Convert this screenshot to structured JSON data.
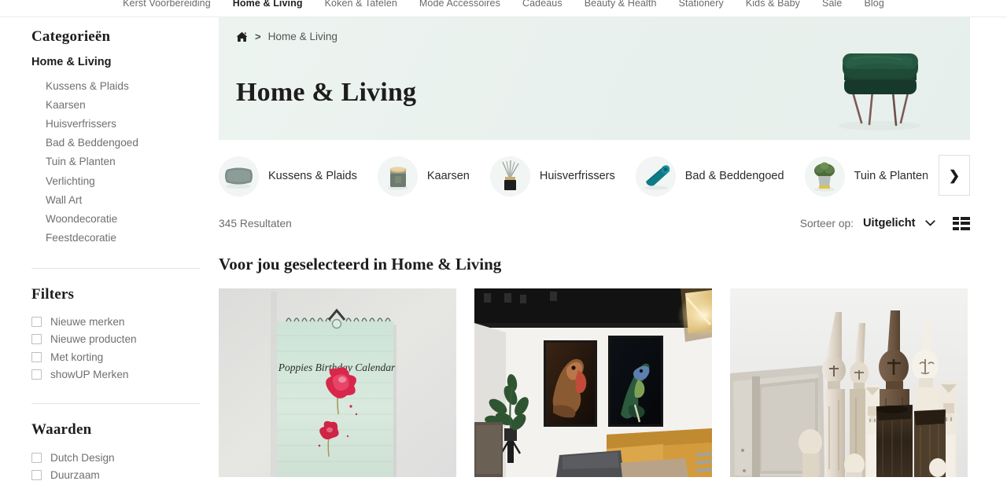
{
  "topnav": {
    "items": [
      {
        "label": "Kerst Voorbereiding",
        "active": false
      },
      {
        "label": "Home & Living",
        "active": true
      },
      {
        "label": "Koken & Tafelen",
        "active": false
      },
      {
        "label": "Mode Accessoires",
        "active": false
      },
      {
        "label": "Cadeaus",
        "active": false
      },
      {
        "label": "Beauty & Health",
        "active": false
      },
      {
        "label": "Stationery",
        "active": false
      },
      {
        "label": "Kids & Baby",
        "active": false
      },
      {
        "label": "Sale",
        "active": false
      },
      {
        "label": "Blog",
        "active": false
      }
    ]
  },
  "sidebar": {
    "categories_heading": "Categorieën",
    "root_category": "Home & Living",
    "subcategories": [
      "Kussens & Plaids",
      "Kaarsen",
      "Huisverfrissers",
      "Bad & Beddengoed",
      "Tuin & Planten",
      "Verlichting",
      "Wall Art",
      "Woondecoratie",
      "Feestdecoratie"
    ],
    "filters_heading": "Filters",
    "filters": [
      {
        "label": "Nieuwe merken",
        "checked": false
      },
      {
        "label": "Nieuwe producten",
        "checked": false
      },
      {
        "label": "Met korting",
        "checked": false
      },
      {
        "label": "showUP Merken",
        "checked": false
      }
    ],
    "values_heading": "Waarden",
    "values": [
      {
        "label": "Dutch Design",
        "checked": false
      },
      {
        "label": "Duurzaam",
        "checked": false
      }
    ]
  },
  "hero": {
    "breadcrumb_home_icon": "home-icon",
    "breadcrumb_separator": ">",
    "breadcrumb_current": "Home & Living",
    "title": "Home & Living",
    "image_alt": "dark green velvet ottoman footstool with thin metal legs",
    "bg_color_left": "#edf4f0",
    "bg_color_right": "#e6efeb"
  },
  "chips": {
    "items": [
      {
        "label": "Kussens & Plaids",
        "thumb": "grey-cushion-thumb"
      },
      {
        "label": "Kaarsen",
        "thumb": "candle-jar-thumb"
      },
      {
        "label": "Huisverfrissers",
        "thumb": "reed-diffuser-thumb"
      },
      {
        "label": "Bad & Beddengoed",
        "thumb": "teal-rolled-towel-thumb"
      },
      {
        "label": "Tuin & Planten",
        "thumb": "potted-plant-thumb"
      }
    ],
    "next_arrow": "›"
  },
  "resultbar": {
    "results_text": "345 Resultaten",
    "sort_label": "Sorteer op:",
    "sort_value": "Uitgelicht",
    "sort_options": [
      "Uitgelicht"
    ],
    "view_toggle_icon": "grid-view-icon"
  },
  "section": {
    "heading": "Voor jou geselecteerd in Home & Living"
  },
  "products": [
    {
      "name": "poppies-birthday-calendar",
      "image_alt": "Spiral-bound wall calendar with watercolour red poppies on mint green paper",
      "calendar_text": "Poppies Birthday Calendar"
    },
    {
      "name": "reptile-wall-art-interior",
      "image_alt": "Interior with two large dark reptile photo posters above a mustard sofa and a plant"
    },
    {
      "name": "carved-wooden-figurines",
      "image_alt": "Weathered whitewashed carved wooden tribal figurines against a white wall"
    }
  ]
}
